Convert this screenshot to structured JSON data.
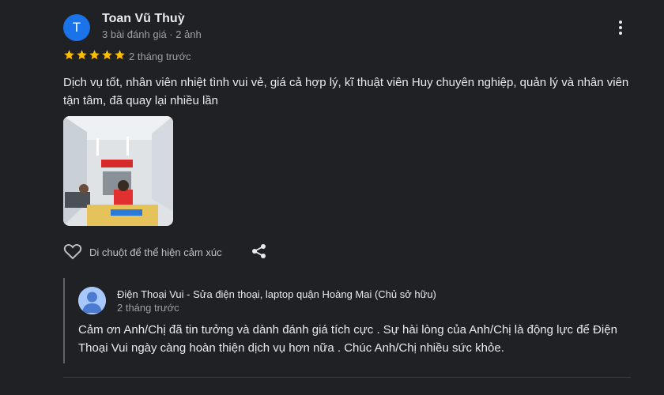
{
  "review": {
    "avatar_letter": "T",
    "reviewer_name": "Toan Vũ Thuỳ",
    "reviewer_meta": "3 bài đánh giá · 2 ảnh",
    "rating": 5,
    "time": "2 tháng trước",
    "text": "Dịch vụ tốt, nhân viên nhiệt tình vui vẻ, giá cả hợp lý, kĩ thuật viên Huy chuyên nghiệp, quản lý và nhân viên tận tâm, đã quay lại nhiều lần",
    "like_label": "Di chuột để thể hiện cảm xúc"
  },
  "reply": {
    "owner_name": "Điện Thoại Vui - Sửa điện thoại, laptop quận Hoàng Mai (Chủ sở hữu)",
    "time": "2 tháng trước",
    "text": "Cảm ơn Anh/Chị đã tin tưởng và dành đánh giá tích cực . Sự hài lòng của Anh/Chị là động lực để Điện Thoại Vui ngày càng hoàn thiện dịch vụ hơn nữa . Chúc Anh/Chị nhiều sức khỏe."
  },
  "colors": {
    "background": "#202124",
    "star": "#fbbc04",
    "avatar": "#1a73e8"
  },
  "icons": [
    "more-vert-icon",
    "star-icon",
    "heart-icon",
    "share-icon",
    "person-icon"
  ]
}
